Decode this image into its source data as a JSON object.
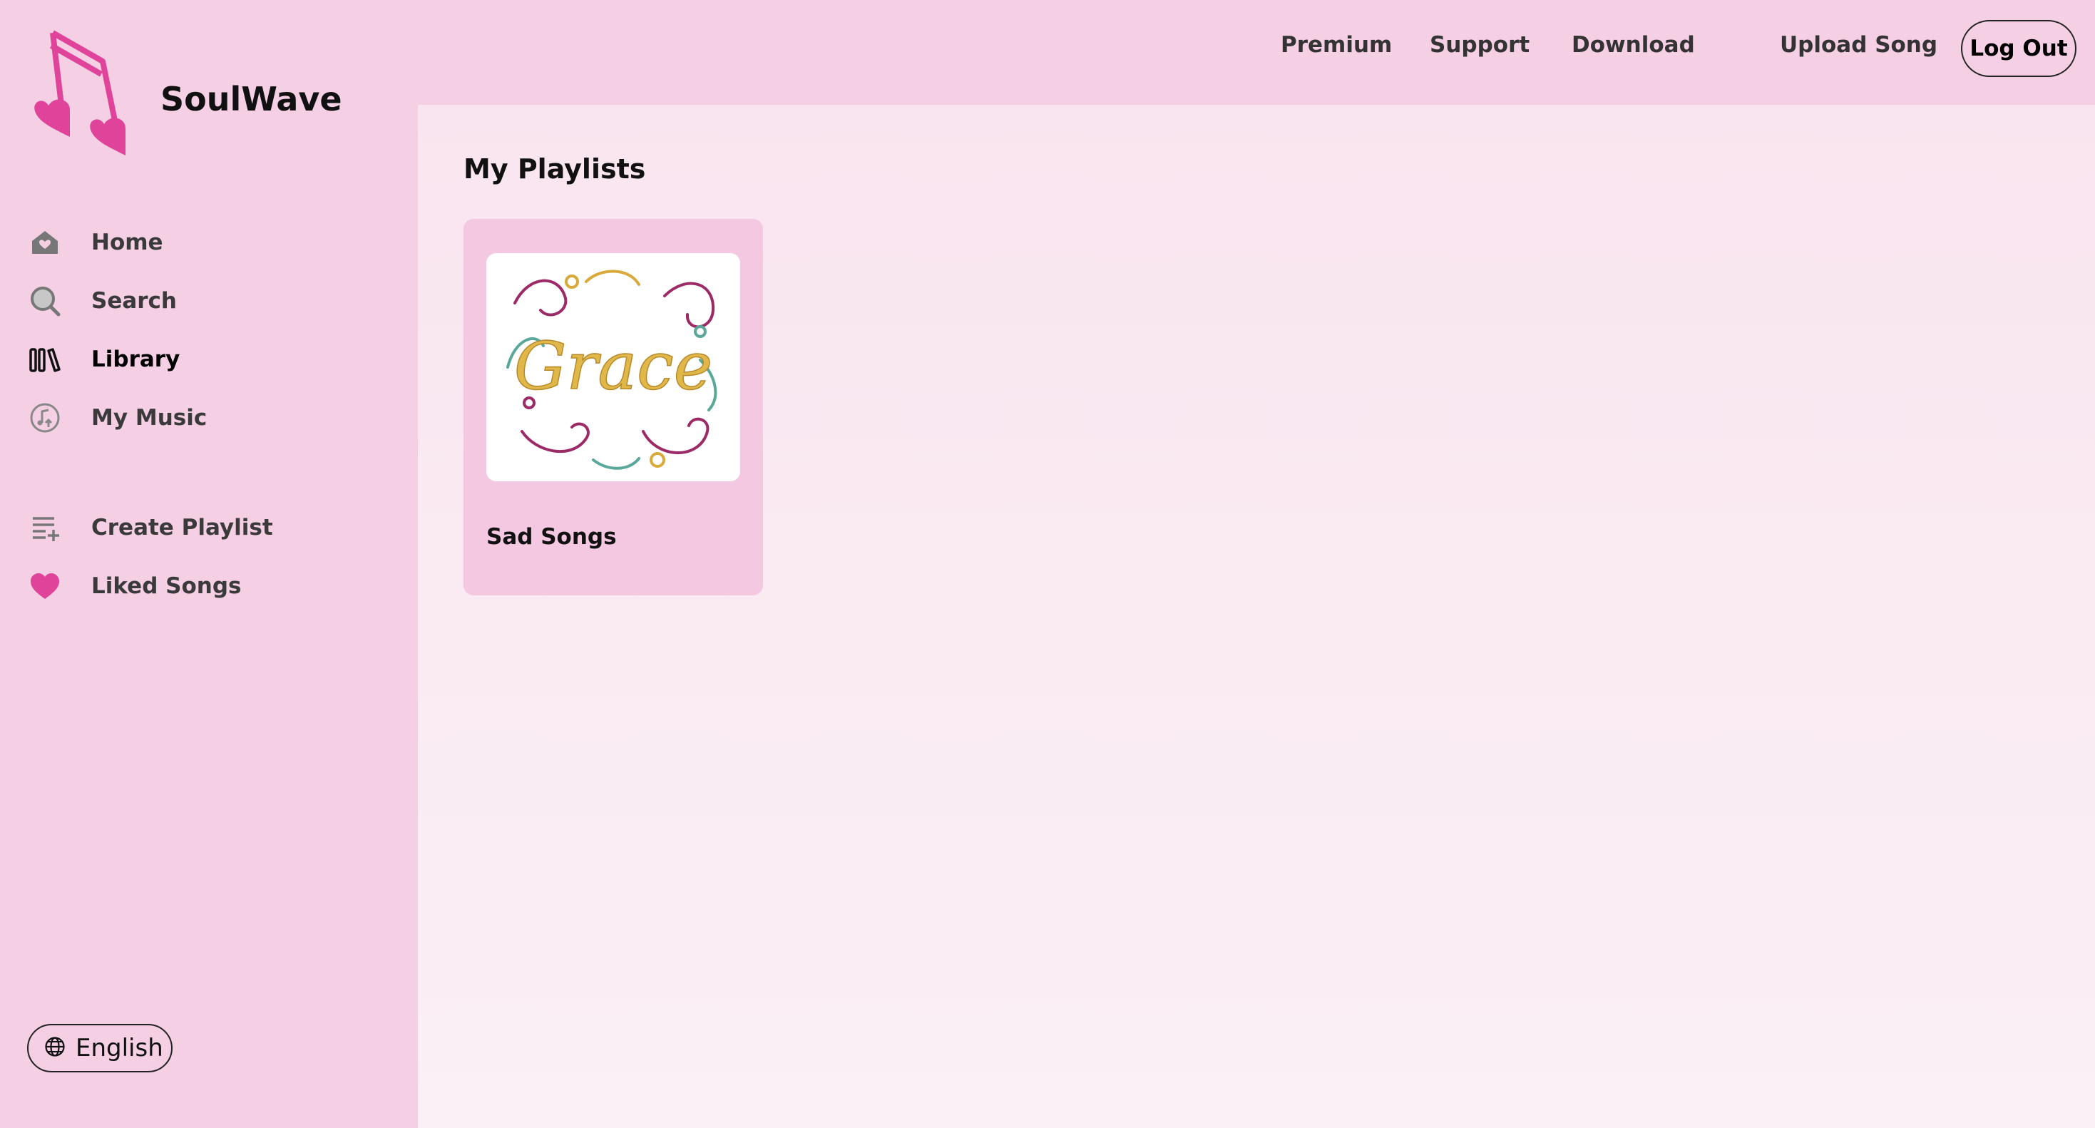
{
  "app": {
    "brand": "SoulWave"
  },
  "sidebar": {
    "items": [
      {
        "label": "Home",
        "icon": "home-heart-icon"
      },
      {
        "label": "Search",
        "icon": "search-icon"
      },
      {
        "label": "Library",
        "icon": "library-icon",
        "active": true
      },
      {
        "label": "My Music",
        "icon": "music-upload-icon"
      },
      {
        "label": "Create Playlist",
        "icon": "playlist-add-icon"
      },
      {
        "label": "Liked Songs",
        "icon": "heart-icon"
      }
    ],
    "language": "English"
  },
  "topbar": {
    "premium": "Premium",
    "support": "Support",
    "download": "Download",
    "upload": "Upload Song",
    "logout": "Log Out"
  },
  "main": {
    "title": "My Playlists",
    "playlists": [
      {
        "title": "Sad Songs",
        "cover_text": "Grace"
      }
    ]
  },
  "colors": {
    "background": "#f5cfe4",
    "accent": "#e0449a",
    "card": "#f3c8e0"
  }
}
